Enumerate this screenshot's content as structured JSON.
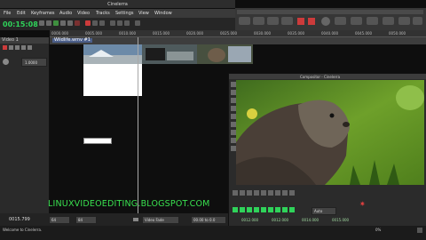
{
  "window": {
    "title": "Cinelerra"
  },
  "menu": [
    "File",
    "Edit",
    "Keyframes",
    "Audio",
    "Video",
    "Tracks",
    "Settings",
    "View",
    "Window"
  ],
  "time": {
    "current": "00:15:08"
  },
  "ruler": {
    "ticks": [
      "0000.000",
      "0005.000",
      "0010.000",
      "0015.000",
      "0020.000",
      "0025.000",
      "0030.000",
      "0035.000",
      "0040.000",
      "0045.000",
      "0050.000"
    ]
  },
  "left_panel": {
    "track_label": "Video 1",
    "value": "1.0000"
  },
  "track": {
    "clip_title": "Wildlife.wmv #1"
  },
  "compositor": {
    "title": "Compositor - Cinelerra",
    "auto_label": "Auto"
  },
  "bottom": {
    "time": "0015.799",
    "fps": "64",
    "val2": "84",
    "zoom_label": "Video Fade",
    "range": "00.00 to 0.0"
  },
  "comp_times": [
    "0012.000",
    "0012.000",
    "0014.000",
    "0015.000"
  ],
  "watermark": "LINUXVIDEOEDITING.BLOGSPOT.COM",
  "status": {
    "text": "Welcome to Cinelerra.",
    "percent": "0%"
  },
  "colors": {
    "accent_red": "#e04040",
    "watermark_green": "#39e14f",
    "time_green": "#2fd35a"
  }
}
